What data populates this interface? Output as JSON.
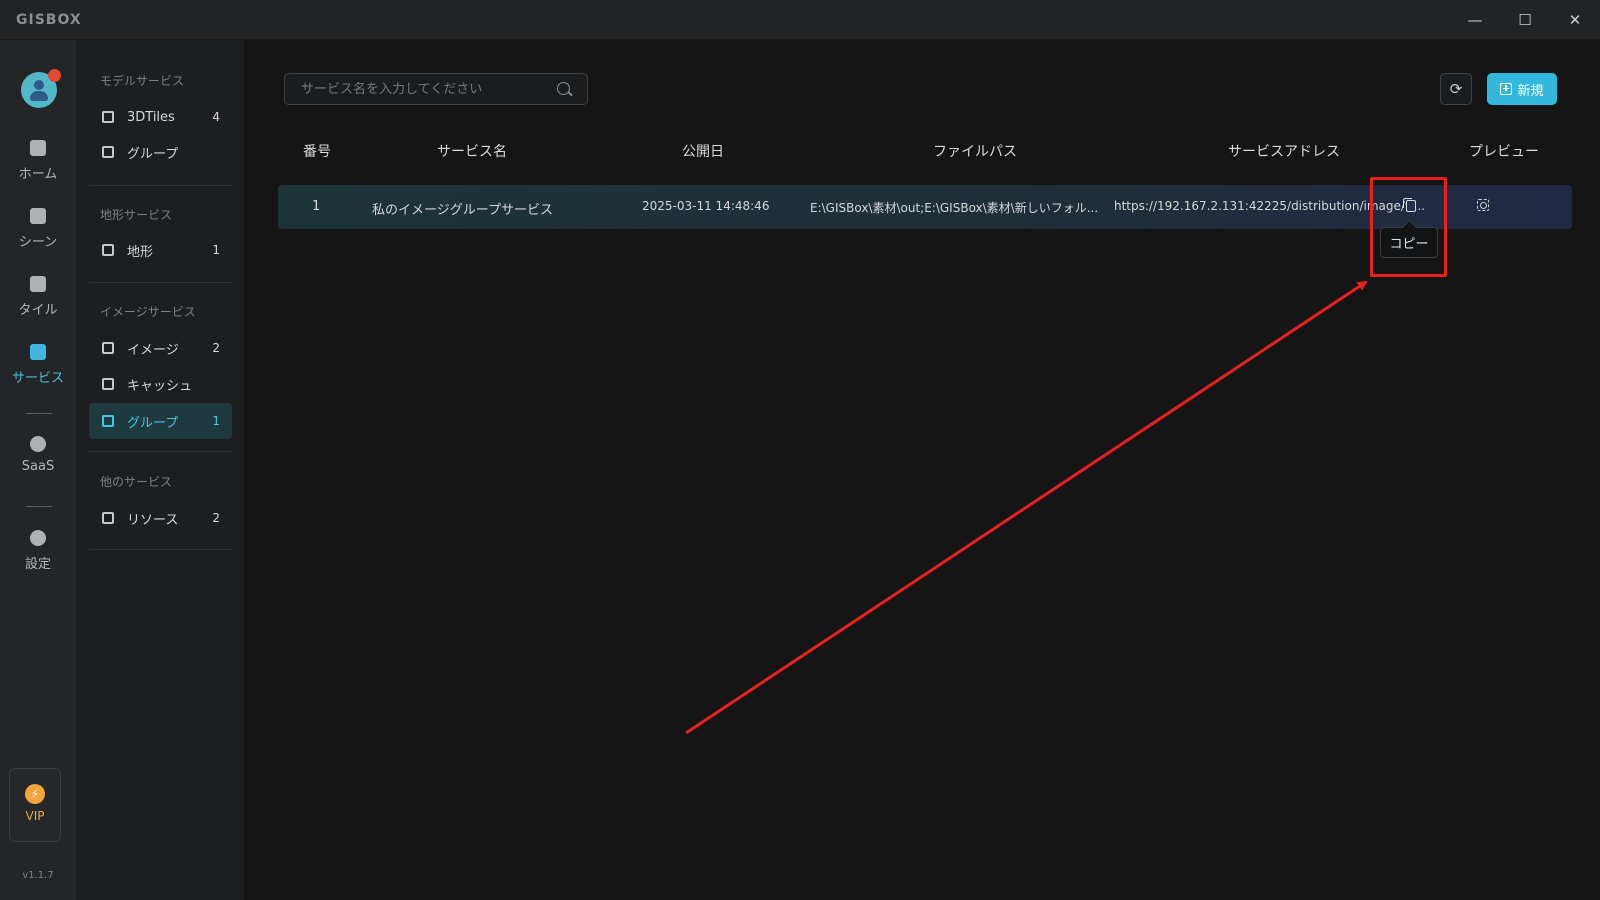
{
  "titlebar": {
    "app_name": "GISBOX",
    "minimize": "—",
    "maximize": "☐",
    "close": "✕"
  },
  "rail": {
    "items": [
      {
        "label": "ホーム",
        "icon": "home-icon"
      },
      {
        "label": "シーン",
        "icon": "scene-icon"
      },
      {
        "label": "タイル",
        "icon": "tile-icon"
      },
      {
        "label": "サービス",
        "icon": "service-icon",
        "active": true
      },
      {
        "label": "SaaS",
        "icon": "saas-icon"
      },
      {
        "label": "設定",
        "icon": "settings-icon"
      }
    ],
    "vip_label": "VIP",
    "version": "v1.1.7"
  },
  "submenu": {
    "groups": [
      {
        "title": "モデルサービス",
        "items": [
          {
            "label": "3DTiles",
            "count": "4"
          },
          {
            "label": "グループ",
            "count": ""
          }
        ]
      },
      {
        "title": "地形サービス",
        "items": [
          {
            "label": "地形",
            "count": "1"
          }
        ]
      },
      {
        "title": "イメージサービス",
        "items": [
          {
            "label": "イメージ",
            "count": "2"
          },
          {
            "label": "キャッシュ",
            "count": ""
          },
          {
            "label": "グループ",
            "count": "1",
            "active": true
          }
        ]
      },
      {
        "title": "他のサービス",
        "items": [
          {
            "label": "リソース",
            "count": "2"
          }
        ]
      }
    ]
  },
  "toolbar": {
    "search_placeholder": "サービス名を入力してください",
    "new_label": "新規"
  },
  "table": {
    "headers": [
      "番号",
      "サービス名",
      "公開日",
      "ファイルパス",
      "サービスアドレス",
      "プレビュー"
    ],
    "rows": [
      {
        "no": "1",
        "name": "私のイメージグループサービス",
        "date": "2025-03-11 14:48:46",
        "path": "E:\\GISBox\\素材\\out;E:\\GISBox\\素材\\新しいフォル...",
        "address": "https://192.167.2.131:42225/distribution/image/w..."
      }
    ]
  },
  "tooltip": "コピー",
  "colors": {
    "accent": "#32b8dc",
    "annotation": "#e8211c"
  }
}
